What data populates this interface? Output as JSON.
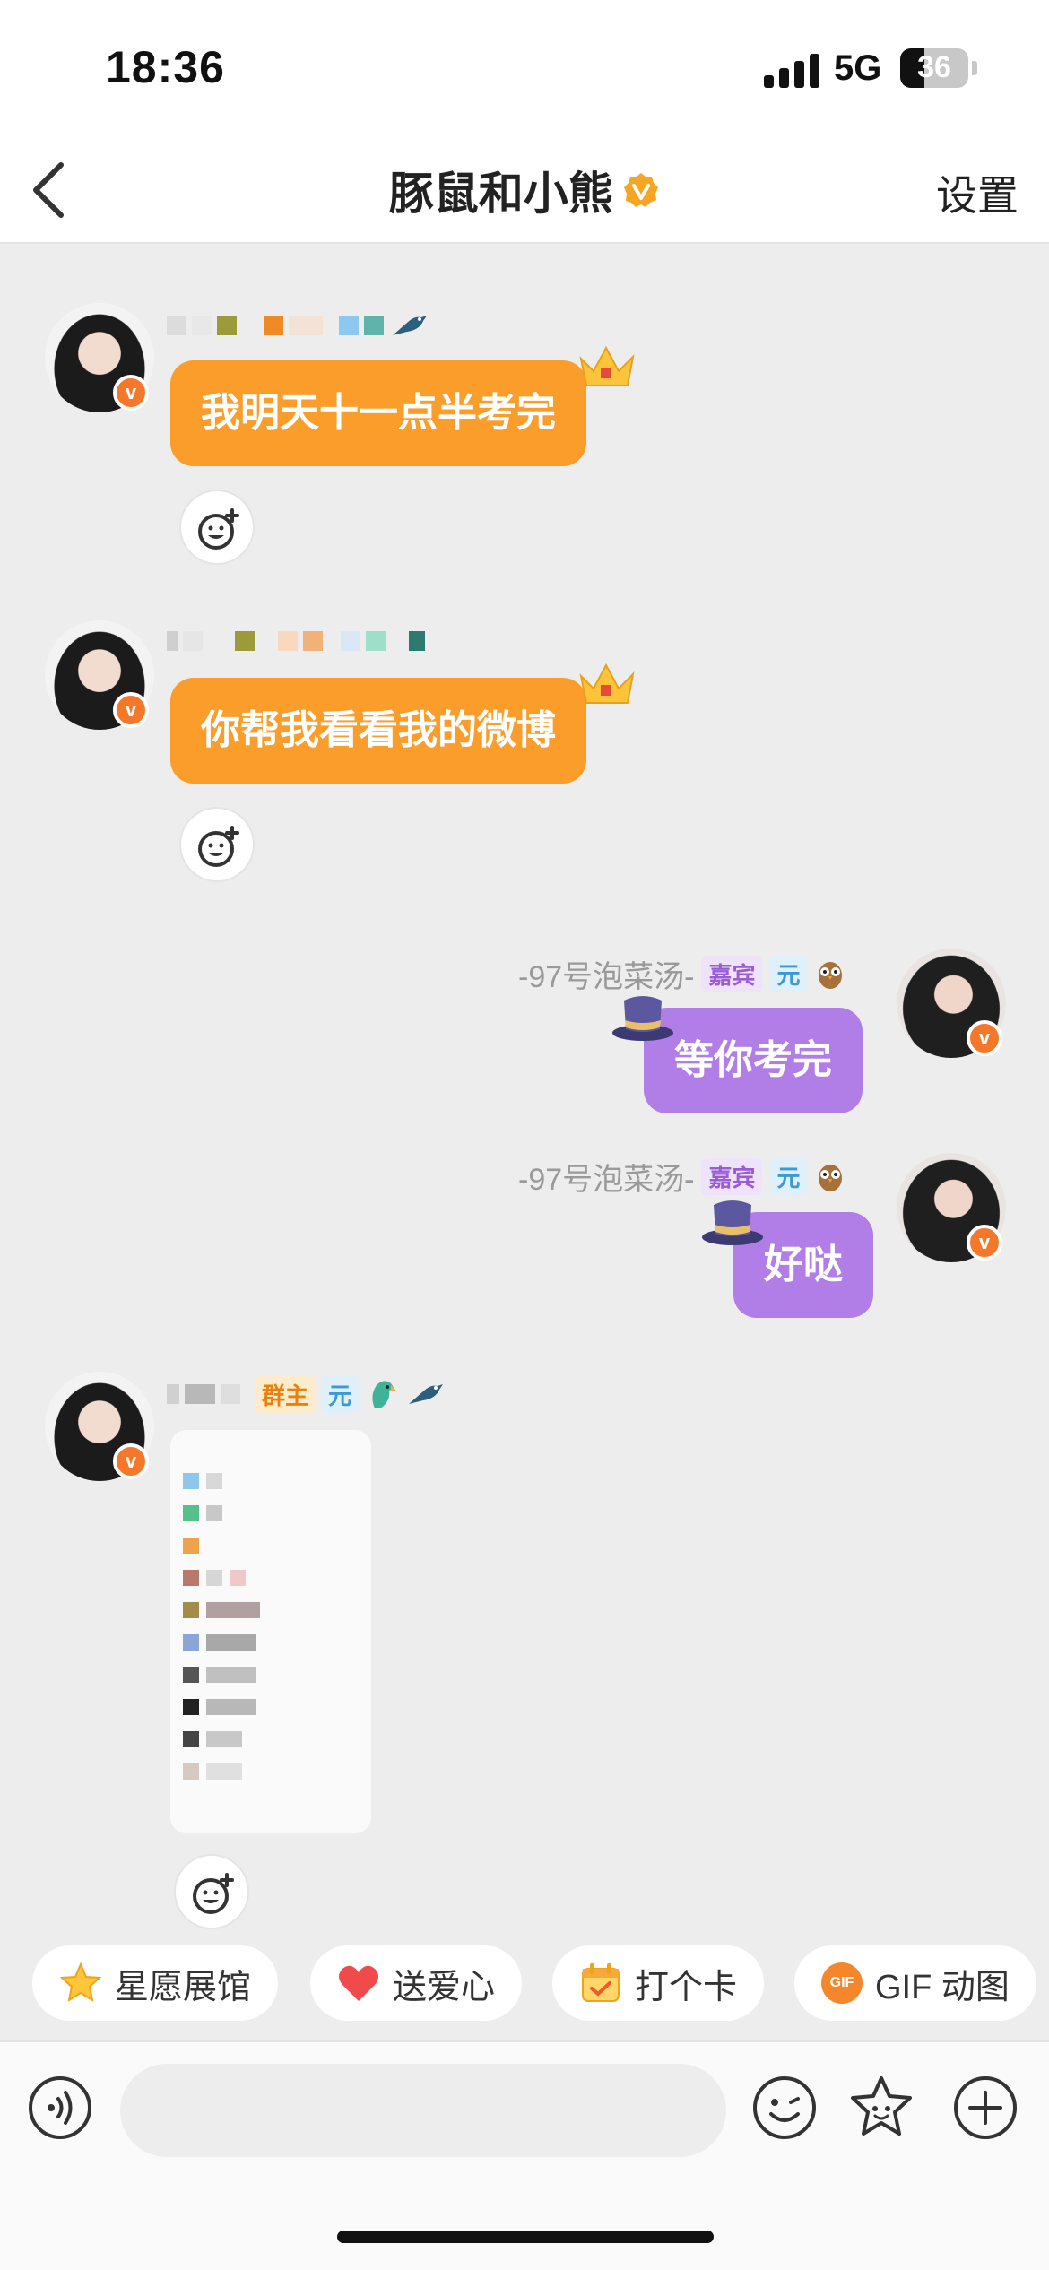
{
  "status_bar": {
    "time": "18:36",
    "network": "5G",
    "battery": "36",
    "battery_level": 0.36
  },
  "header": {
    "title": "豚鼠和小熊",
    "settings_label": "设置"
  },
  "messages": [
    {
      "side": "left",
      "text": "我明天十一点半考完"
    },
    {
      "side": "left",
      "text": "你帮我看看我的微博"
    },
    {
      "side": "right",
      "sender": "-97号泡菜汤-",
      "tags": [
        "嘉宾",
        "元"
      ],
      "text": "等你考完"
    },
    {
      "side": "right",
      "sender": "-97号泡菜汤-",
      "tags": [
        "嘉宾",
        "元"
      ],
      "text": "好哒"
    },
    {
      "side": "left",
      "tags": [
        "群主",
        "元"
      ],
      "type": "image"
    }
  ],
  "quick_actions": [
    "星愿展馆",
    "送爱心",
    "打个卡",
    "GIF 动图"
  ],
  "quick_action_gif_badge": "GIF",
  "input_bar": {
    "icons": [
      "voice-icon",
      "emoji-icon",
      "sticker-icon",
      "plus-icon"
    ]
  },
  "colors": {
    "accent_orange": "#fb9d2b",
    "bubble_purple": "#b07ee6",
    "verified_orange": "#f5772a"
  }
}
